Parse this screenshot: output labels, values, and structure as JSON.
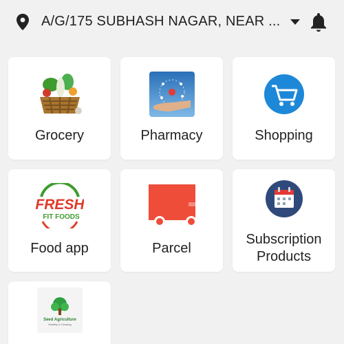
{
  "header": {
    "address": "A/G/175 SUBHASH NAGAR, NEAR ..."
  },
  "services": [
    {
      "label": "Grocery",
      "icon": "grocery-basket-icon"
    },
    {
      "label": "Pharmacy",
      "icon": "pharmacy-icon"
    },
    {
      "label": "Shopping",
      "icon": "shopping-cart-icon"
    },
    {
      "label": "Food app",
      "icon": "fresh-fit-foods-logo"
    },
    {
      "label": "Parcel",
      "icon": "delivery-truck-icon"
    },
    {
      "label": "Subscription\nProducts",
      "icon": "calendar-icon"
    },
    {
      "label": "",
      "icon": "seed-agriculture-logo"
    }
  ],
  "logos": {
    "food": {
      "line1": "FRESH",
      "line2": "FIT FOODS"
    },
    "seed": {
      "line1": "Seed Agriculture",
      "line2": "Healthy & Growing"
    }
  },
  "colors": {
    "background": "#f1f1f1",
    "card": "#ffffff",
    "shopping_blue": "#1e88d8",
    "parcel_red": "#ee4d3a",
    "calendar_navy": "#2f4a7a"
  }
}
